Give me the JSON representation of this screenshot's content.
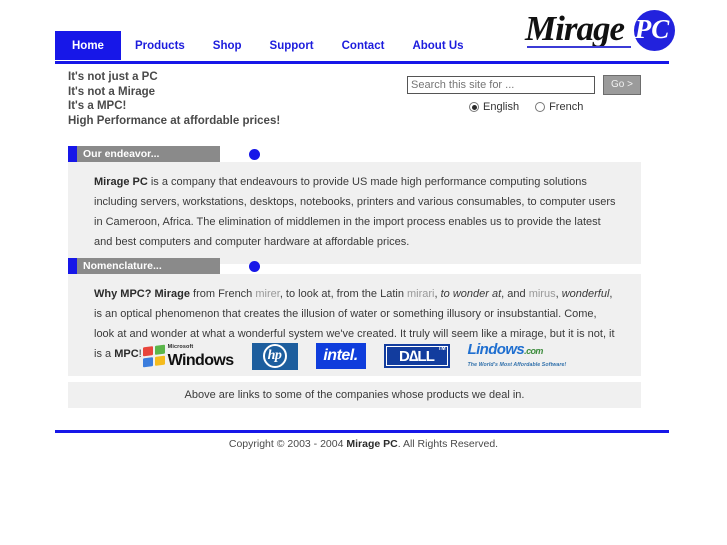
{
  "site": {
    "logo_word": "Mirage",
    "logo_badge": "PC"
  },
  "nav": {
    "items": [
      {
        "label": "Home",
        "active": true
      },
      {
        "label": "Products",
        "active": false
      },
      {
        "label": "Shop",
        "active": false
      },
      {
        "label": "Support",
        "active": false
      },
      {
        "label": "Contact",
        "active": false
      },
      {
        "label": "About Us",
        "active": false
      }
    ]
  },
  "tagline": {
    "lines": [
      "It's not just a PC",
      "It's not a Mirage",
      "It's a MPC!",
      "High Performance at affordable prices!"
    ]
  },
  "search": {
    "placeholder": "Search this site for ...",
    "value": "",
    "button_label": "Go >",
    "languages": [
      {
        "label": "English",
        "selected": true
      },
      {
        "label": "French",
        "selected": false
      }
    ]
  },
  "panels": [
    {
      "title": "Our endeavor...",
      "lead": "Mirage PC",
      "text": " is a company that endeavours to provide US made high performance computing solutions including servers, workstations, desktops, notebooks, printers and various consumables, to computer users in Cameroon, Africa. The elimination of middlemen in the import process enables us to provide the latest and best computers and computer hardware at affordable prices."
    },
    {
      "title": "Nomenclature...",
      "lead": "Why MPC? Mirage",
      "seg_1": " from French ",
      "word_1": "mirer",
      "seg_2": ", to look at, from the Latin ",
      "word_2": "mirari",
      "seg_3": ", ",
      "italic_1": "to wonder at",
      "seg_4": ", and ",
      "word_3": "mirus",
      "seg_5": ", ",
      "italic_2": "wonderful",
      "seg_6": ", is an optical phenomenon that creates the illusion of water or something illusory or insubstantial. Come, look at and wonder at what a wonderful system we've created. It truly will seem like a mirage, but it is not, it is a ",
      "tail_bold": "MPC",
      "seg_7": "!"
    }
  ],
  "partners": {
    "logos": [
      {
        "name": "Microsoft Windows",
        "brand": "Microsoft",
        "label": "Windows"
      },
      {
        "name": "HP",
        "label": "hp"
      },
      {
        "name": "Intel",
        "label": "intel."
      },
      {
        "name": "Dell",
        "label": "D∆LL",
        "tm": "TM"
      },
      {
        "name": "Lindows.com",
        "label": "Lindows",
        "suffix": ".com",
        "tagline": "The World's Most Affordable Software!"
      }
    ],
    "caption": "Above are links to some of the companies whose products we deal in."
  },
  "footer": {
    "copyright_pre": "Copyright © 2003 - 2004 ",
    "copyright_brand": "Mirage PC",
    "copyright_post": ". All Rights Reserved."
  },
  "colors": {
    "brand_blue": "#1717e8",
    "panel_head_gray": "#8a8a8a",
    "panel_body_gray": "#f0f0f0"
  }
}
